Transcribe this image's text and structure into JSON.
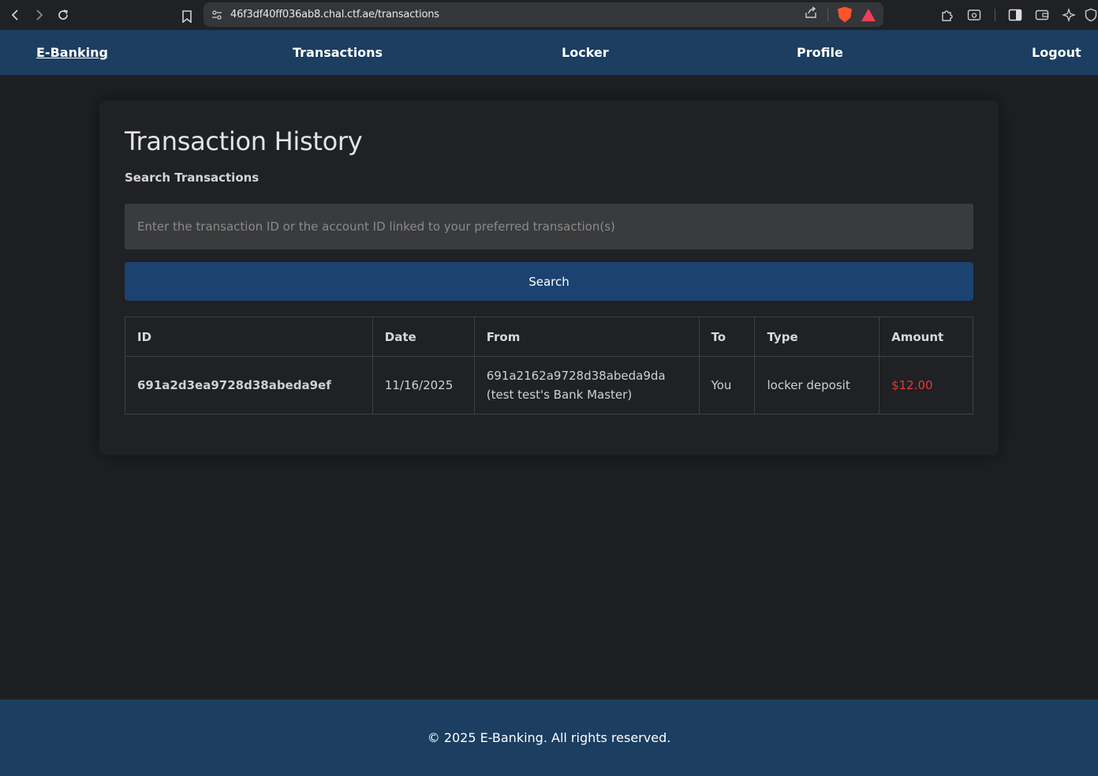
{
  "browser": {
    "url": "46f3df40ff036ab8.chal.ctf.ae/transactions",
    "icons": [
      "back-icon",
      "forward-icon",
      "reload-icon",
      "bookmark-icon",
      "site-settings-icon",
      "share-icon",
      "brave-shields-icon",
      "brave-rewards-icon",
      "extensions-icon",
      "screenshot-icon",
      "sidebar-icon",
      "wallet-icon",
      "leo-ai-icon",
      "vpn-icon"
    ]
  },
  "nav": {
    "brand": "E-Banking",
    "transactions": "Transactions",
    "locker": "Locker",
    "profile": "Profile",
    "logout": "Logout"
  },
  "page": {
    "title": "Transaction History",
    "search_label": "Search Transactions",
    "search_placeholder": "Enter the transaction ID or the account ID linked to your preferred transaction(s)",
    "search_button": "Search"
  },
  "table": {
    "headers": [
      "ID",
      "Date",
      "From",
      "To",
      "Type",
      "Amount"
    ],
    "rows": [
      {
        "id": "691a2d3ea9728d38abeda9ef",
        "date": "11/16/2025",
        "from_account": "691a2162a9728d38abeda9da",
        "from_name": "(test test's Bank Master)",
        "to": "You",
        "type": "locker deposit",
        "amount": "$12.00"
      }
    ]
  },
  "footer": {
    "text": "© 2025 E-Banking. All rights reserved."
  },
  "colors": {
    "nav_bg": "#1b3e61",
    "button_bg": "#1b4270",
    "page_bg": "#1d1f23",
    "amount_negative": "#e5383b"
  }
}
